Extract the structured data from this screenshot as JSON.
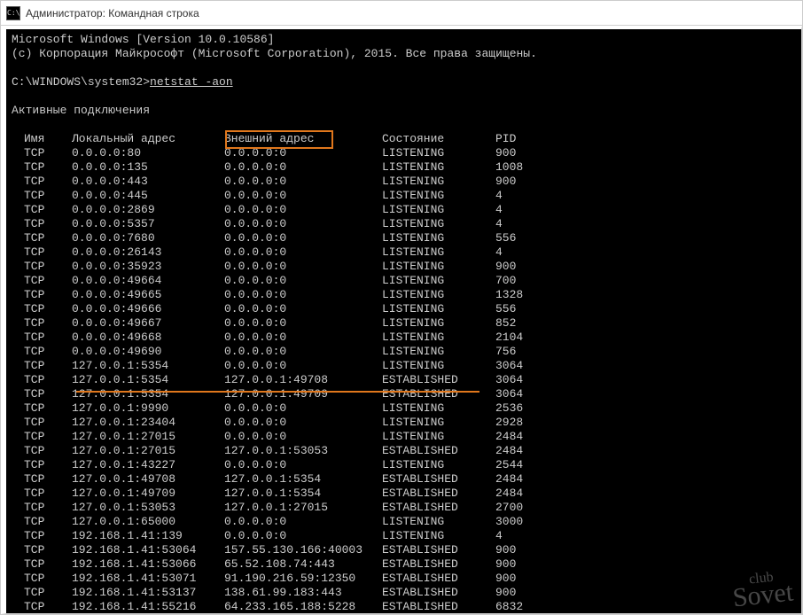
{
  "window": {
    "title": "Администратор: Командная строка",
    "icon_label": "C:\\"
  },
  "banner": {
    "line1": "Microsoft Windows [Version 10.0.10586]",
    "line2": "(c) Корпорация Майкрософт (Microsoft Corporation), 2015. Все права защищены."
  },
  "prompt": {
    "path": "C:\\WINDOWS\\system32>",
    "command": "netstat -aon"
  },
  "section_title": "Активные подключения",
  "headers": {
    "proto": "Имя",
    "local": "Локальный адрес",
    "foreign": "Внешний адрес",
    "state": "Состояние",
    "pid": "PID"
  },
  "rows": [
    {
      "proto": "TCP",
      "local": "0.0.0.0:80",
      "foreign": "0.0.0.0:0",
      "state": "LISTENING",
      "pid": "900"
    },
    {
      "proto": "TCP",
      "local": "0.0.0.0:135",
      "foreign": "0.0.0.0:0",
      "state": "LISTENING",
      "pid": "1008"
    },
    {
      "proto": "TCP",
      "local": "0.0.0.0:443",
      "foreign": "0.0.0.0:0",
      "state": "LISTENING",
      "pid": "900"
    },
    {
      "proto": "TCP",
      "local": "0.0.0.0:445",
      "foreign": "0.0.0.0:0",
      "state": "LISTENING",
      "pid": "4"
    },
    {
      "proto": "TCP",
      "local": "0.0.0.0:2869",
      "foreign": "0.0.0.0:0",
      "state": "LISTENING",
      "pid": "4"
    },
    {
      "proto": "TCP",
      "local": "0.0.0.0:5357",
      "foreign": "0.0.0.0:0",
      "state": "LISTENING",
      "pid": "4"
    },
    {
      "proto": "TCP",
      "local": "0.0.0.0:7680",
      "foreign": "0.0.0.0:0",
      "state": "LISTENING",
      "pid": "556"
    },
    {
      "proto": "TCP",
      "local": "0.0.0.0:26143",
      "foreign": "0.0.0.0:0",
      "state": "LISTENING",
      "pid": "4"
    },
    {
      "proto": "TCP",
      "local": "0.0.0.0:35923",
      "foreign": "0.0.0.0:0",
      "state": "LISTENING",
      "pid": "900"
    },
    {
      "proto": "TCP",
      "local": "0.0.0.0:49664",
      "foreign": "0.0.0.0:0",
      "state": "LISTENING",
      "pid": "700"
    },
    {
      "proto": "TCP",
      "local": "0.0.0.0:49665",
      "foreign": "0.0.0.0:0",
      "state": "LISTENING",
      "pid": "1328"
    },
    {
      "proto": "TCP",
      "local": "0.0.0.0:49666",
      "foreign": "0.0.0.0:0",
      "state": "LISTENING",
      "pid": "556"
    },
    {
      "proto": "TCP",
      "local": "0.0.0.0:49667",
      "foreign": "0.0.0.0:0",
      "state": "LISTENING",
      "pid": "852"
    },
    {
      "proto": "TCP",
      "local": "0.0.0.0:49668",
      "foreign": "0.0.0.0:0",
      "state": "LISTENING",
      "pid": "2104"
    },
    {
      "proto": "TCP",
      "local": "0.0.0.0:49690",
      "foreign": "0.0.0.0:0",
      "state": "LISTENING",
      "pid": "756"
    },
    {
      "proto": "TCP",
      "local": "127.0.0.1:5354",
      "foreign": "0.0.0.0:0",
      "state": "LISTENING",
      "pid": "3064"
    },
    {
      "proto": "TCP",
      "local": "127.0.0.1:5354",
      "foreign": "127.0.0.1:49708",
      "state": "ESTABLISHED",
      "pid": "3064"
    },
    {
      "proto": "TCP",
      "local": "127.0.0.1:5354",
      "foreign": "127.0.0.1:49709",
      "state": "ESTABLISHED",
      "pid": "3064"
    },
    {
      "proto": "TCP",
      "local": "127.0.0.1:9990",
      "foreign": "0.0.0.0:0",
      "state": "LISTENING",
      "pid": "2536"
    },
    {
      "proto": "TCP",
      "local": "127.0.0.1:23404",
      "foreign": "0.0.0.0:0",
      "state": "LISTENING",
      "pid": "2928"
    },
    {
      "proto": "TCP",
      "local": "127.0.0.1:27015",
      "foreign": "0.0.0.0:0",
      "state": "LISTENING",
      "pid": "2484"
    },
    {
      "proto": "TCP",
      "local": "127.0.0.1:27015",
      "foreign": "127.0.0.1:53053",
      "state": "ESTABLISHED",
      "pid": "2484"
    },
    {
      "proto": "TCP",
      "local": "127.0.0.1:43227",
      "foreign": "0.0.0.0:0",
      "state": "LISTENING",
      "pid": "2544"
    },
    {
      "proto": "TCP",
      "local": "127.0.0.1:49708",
      "foreign": "127.0.0.1:5354",
      "state": "ESTABLISHED",
      "pid": "2484"
    },
    {
      "proto": "TCP",
      "local": "127.0.0.1:49709",
      "foreign": "127.0.0.1:5354",
      "state": "ESTABLISHED",
      "pid": "2484"
    },
    {
      "proto": "TCP",
      "local": "127.0.0.1:53053",
      "foreign": "127.0.0.1:27015",
      "state": "ESTABLISHED",
      "pid": "2700"
    },
    {
      "proto": "TCP",
      "local": "127.0.0.1:65000",
      "foreign": "0.0.0.0:0",
      "state": "LISTENING",
      "pid": "3000"
    },
    {
      "proto": "TCP",
      "local": "192.168.1.41:139",
      "foreign": "0.0.0.0:0",
      "state": "LISTENING",
      "pid": "4"
    },
    {
      "proto": "TCP",
      "local": "192.168.1.41:53064",
      "foreign": "157.55.130.166:40003",
      "state": "ESTABLISHED",
      "pid": "900"
    },
    {
      "proto": "TCP",
      "local": "192.168.1.41:53066",
      "foreign": "65.52.108.74:443",
      "state": "ESTABLISHED",
      "pid": "900"
    },
    {
      "proto": "TCP",
      "local": "192.168.1.41:53071",
      "foreign": "91.190.216.59:12350",
      "state": "ESTABLISHED",
      "pid": "900"
    },
    {
      "proto": "TCP",
      "local": "192.168.1.41:53137",
      "foreign": "138.61.99.183:443",
      "state": "ESTABLISHED",
      "pid": "900"
    },
    {
      "proto": "TCP",
      "local": "192.168.1.41:55216",
      "foreign": "64.233.165.188:5228",
      "state": "ESTABLISHED",
      "pid": "6832"
    }
  ],
  "watermark": {
    "top": "club",
    "main": "Sovet"
  }
}
